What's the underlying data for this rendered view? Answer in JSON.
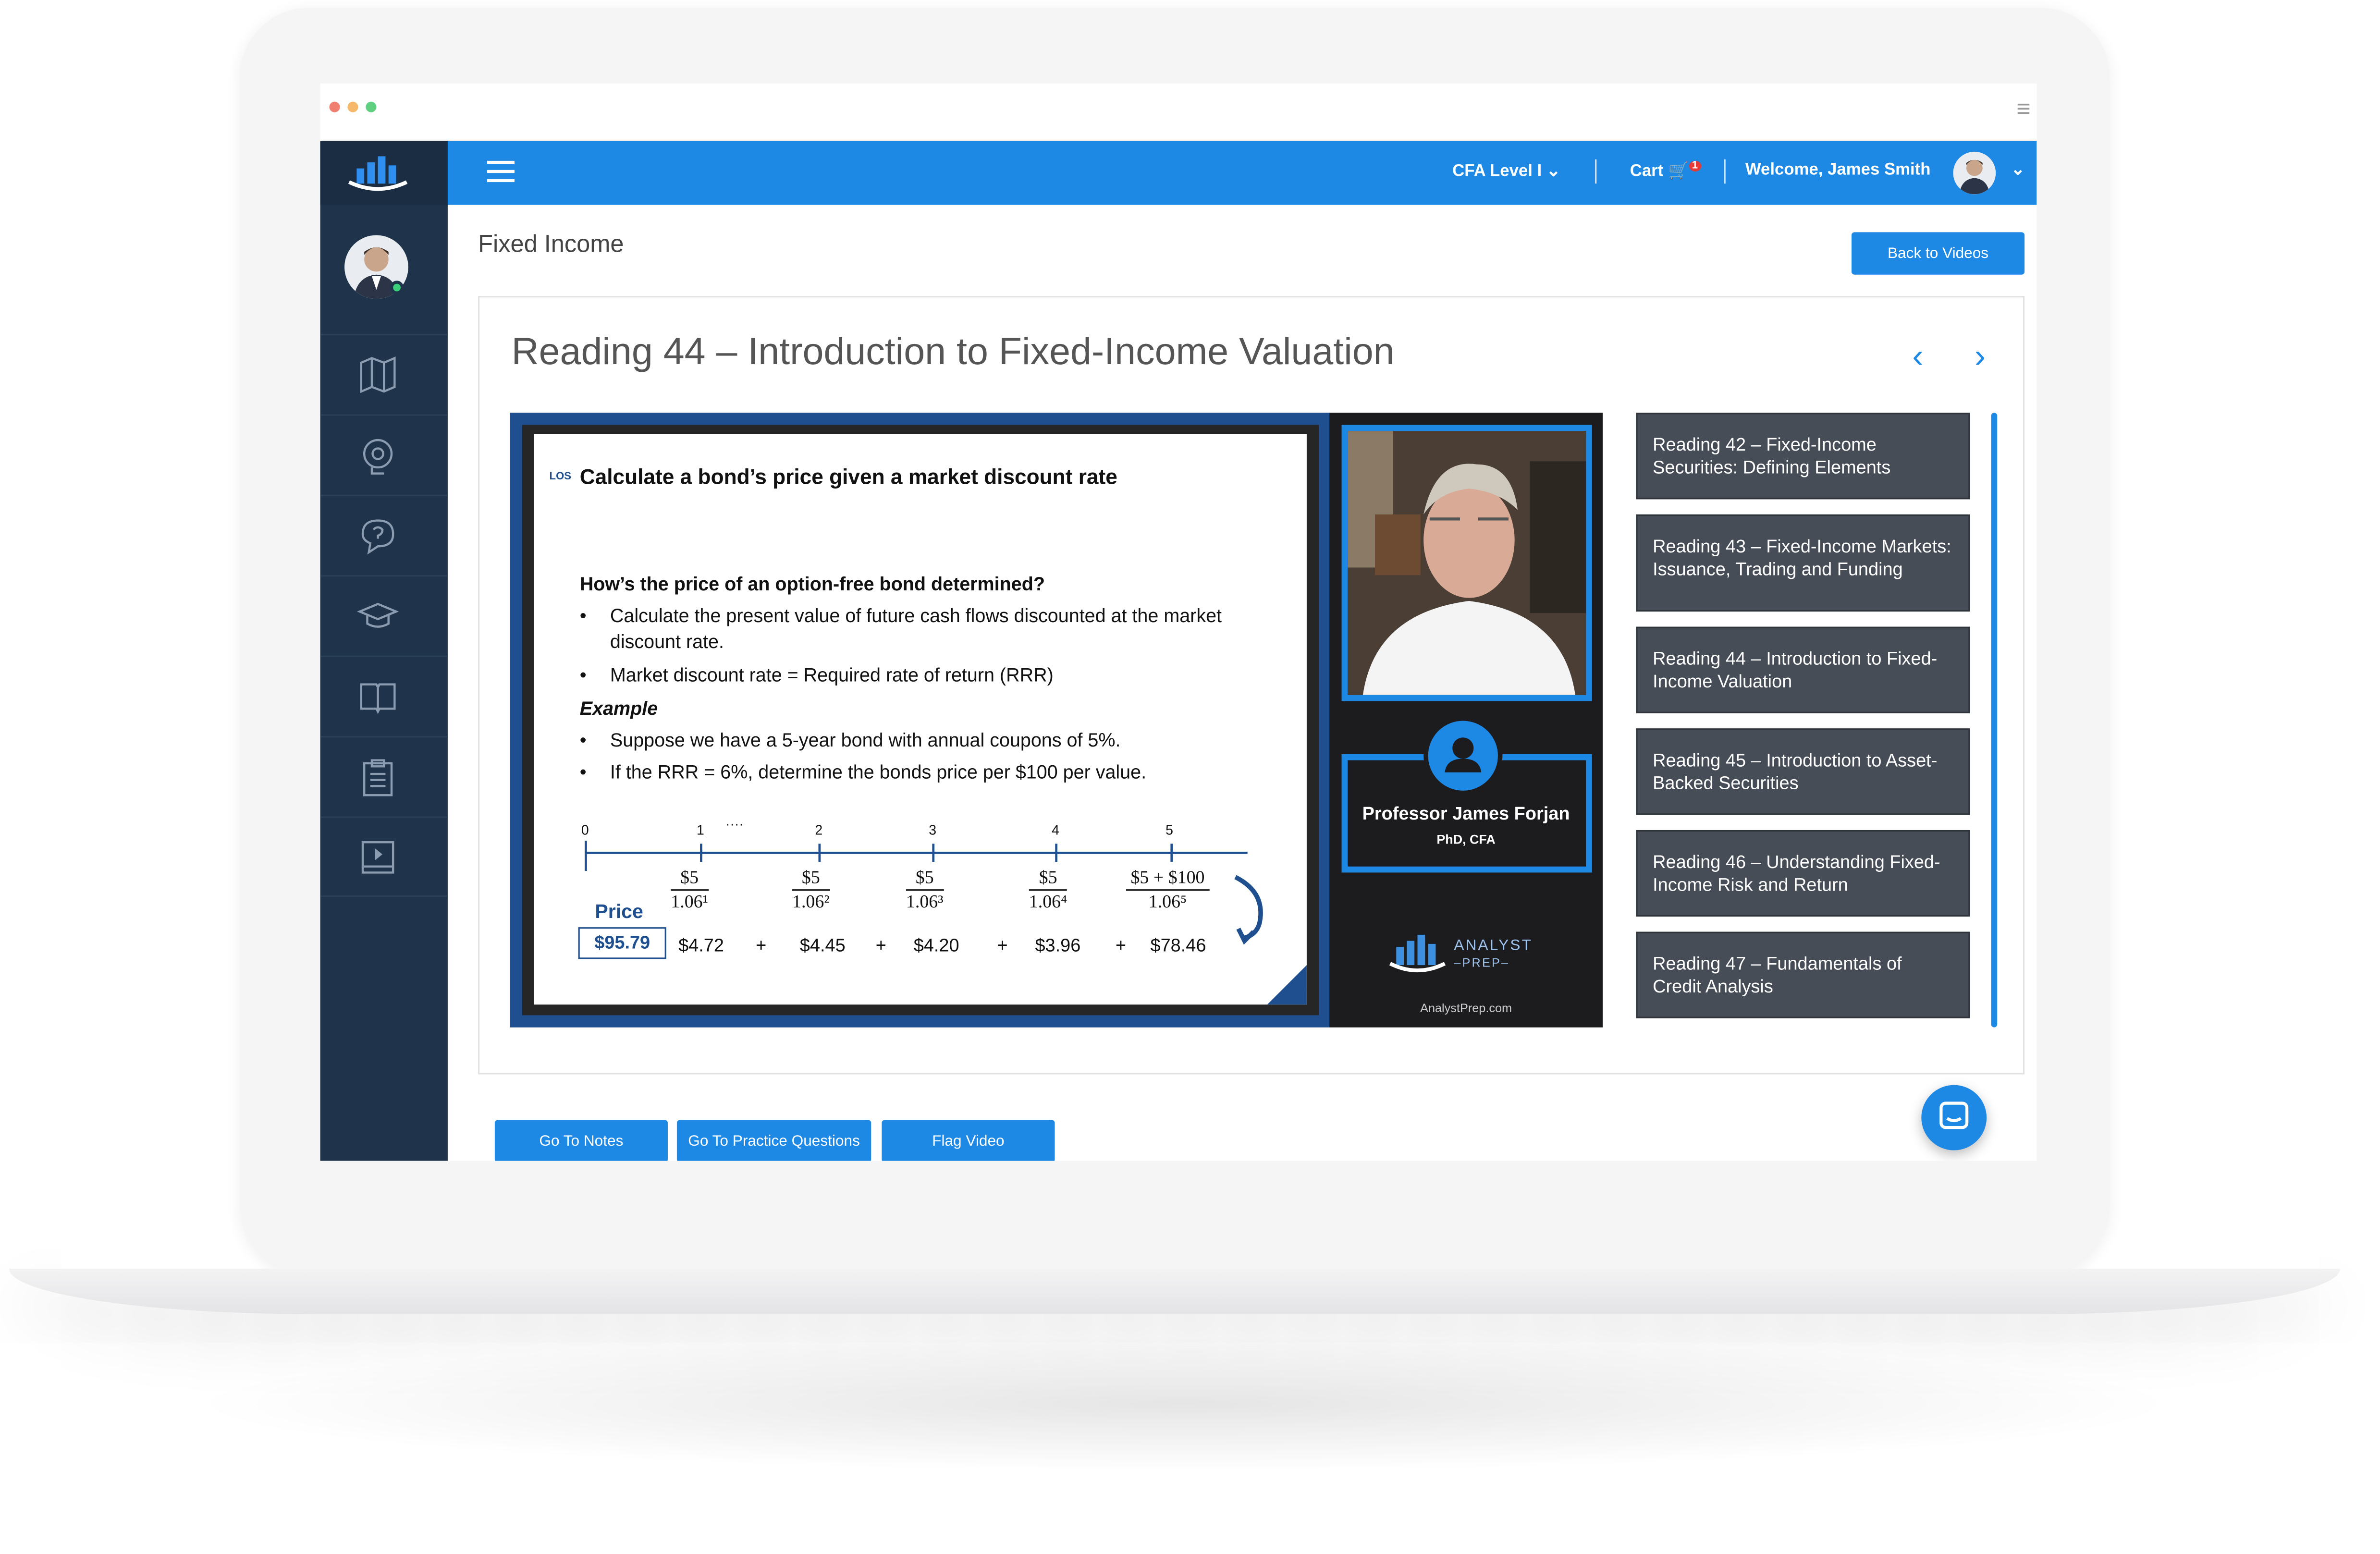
{
  "titlebar": {
    "dots": [
      {
        "name": "close",
        "color": "#f07f6f"
      },
      {
        "name": "minimize",
        "color": "#f6b96b"
      },
      {
        "name": "maximize",
        "color": "#5fd07f"
      }
    ],
    "menu_icon": "hamburger-icon"
  },
  "colors": {
    "accent": "#1e88e5",
    "sidebar": "#1f344b",
    "playlist_item": "#474d57"
  },
  "header": {
    "level_label": "CFA Level I",
    "cart_label": "Cart",
    "cart_count": "1",
    "welcome_label": "Welcome, James Smith"
  },
  "sidebar": {
    "items": [
      {
        "icon": "map-icon"
      },
      {
        "icon": "brain-gear-icon"
      },
      {
        "icon": "question-chat-icon"
      },
      {
        "icon": "graduation-cap-icon"
      },
      {
        "icon": "open-book-icon"
      },
      {
        "icon": "clipboard-list-icon"
      },
      {
        "icon": "video-book-icon"
      }
    ]
  },
  "page": {
    "title": "Fixed Income",
    "back_button": "Back to Videos",
    "reading_title": "Reading 44 – Introduction to Fixed-Income Valuation",
    "prev_arrow": "‹",
    "next_arrow": "›"
  },
  "slide": {
    "los": "LOS",
    "heading": "Calculate a bond’s price given a market discount rate",
    "question": "How’s the price of an option-free bond determined?",
    "bullets": [
      "Calculate the present value of future cash flows discounted at the market discount rate.",
      "Market discount rate = Required rate of return (RRR)"
    ],
    "example_label": "Example",
    "example_bullets": [
      "Suppose we have a 5-year bond with annual coupons of 5%.",
      "If the RRR = 6%, determine the bonds price per $100 per value."
    ],
    "timeline": [
      "0",
      "1",
      "2",
      "3",
      "4",
      "5"
    ],
    "timeline_dots": "····",
    "numerators": [
      "$5",
      "$5",
      "$5",
      "$5",
      "$5 + $100"
    ],
    "denominators": [
      "1.06¹",
      "1.06²",
      "1.06³",
      "1.06⁴",
      "1.06⁵"
    ],
    "price_label": "Price",
    "price_value": "$95.79",
    "pv_values": [
      "$4.72",
      "$4.45",
      "$4.20",
      "$3.96",
      "$78.46"
    ],
    "plus": "+"
  },
  "presenter": {
    "name": "Professor James Forjan",
    "degree": "PhD, CFA",
    "logo_line1": "ANALYST",
    "logo_line2": "–PREP–",
    "url": "AnalystPrep.com"
  },
  "playlist": [
    {
      "label": "Reading 42 – Fixed-Income Securities: Defining Elements"
    },
    {
      "label": "Reading 43 – Fixed-Income Markets: Issuance, Trading and Funding"
    },
    {
      "label": "Reading 44 – Introduction to Fixed-Income Valuation"
    },
    {
      "label": "Reading 45 – Introduction to Asset-Backed Securities"
    },
    {
      "label": "Reading 46 – Understanding Fixed-Income Risk and Return"
    },
    {
      "label": "Reading 47 – Fundamentals of Credit Analysis"
    }
  ],
  "actions": {
    "notes": "Go To Notes",
    "practice": "Go To Practice Questions",
    "flag": "Flag Video"
  }
}
